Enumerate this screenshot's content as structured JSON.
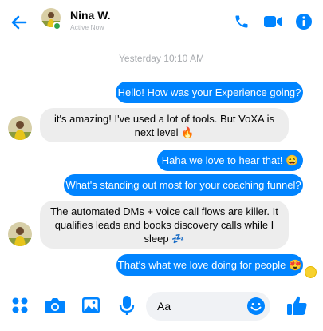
{
  "header": {
    "name": "Nina W.",
    "status": "Active Now"
  },
  "timestamp": "Yesterday 10:10 AM",
  "messages": [
    {
      "side": "out",
      "text": "Hello! How was your Experience going?"
    },
    {
      "side": "in",
      "text": "it's amazing! I've used a lot of tools. But VoXA is next level",
      "emoji": "🔥"
    },
    {
      "side": "out",
      "text": "Haha we love to hear that!",
      "emoji": "😄"
    },
    {
      "side": "out",
      "text": "What's standing out most for your coaching funnel?"
    },
    {
      "side": "in",
      "text": "The automated DMs + voice call flows are killer. It qualifies leads and books discovery calls while I sleep",
      "emoji": "💤"
    },
    {
      "side": "out",
      "text": "That's what we love doing for people",
      "emoji": "😍"
    }
  ],
  "composer": {
    "placeholder": "Aa"
  },
  "colors": {
    "accent": "#0084ff",
    "incoming_bubble": "#ededed",
    "online": "#31a24c"
  },
  "icons": [
    "back-arrow-icon",
    "phone-icon",
    "video-camera-icon",
    "info-icon",
    "apps-icon",
    "camera-icon",
    "gallery-icon",
    "microphone-icon",
    "smiley-icon",
    "thumbs-up-icon"
  ]
}
